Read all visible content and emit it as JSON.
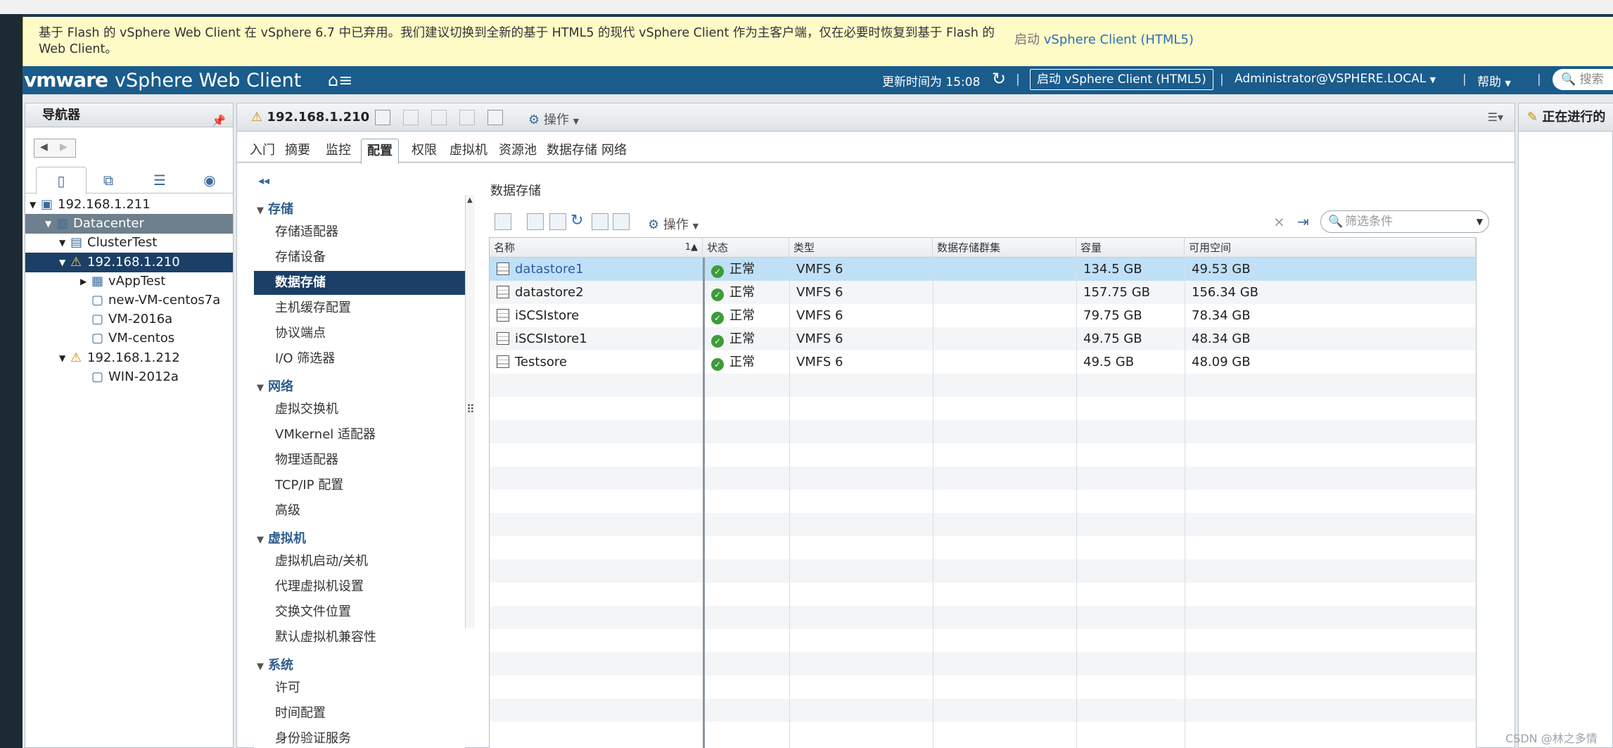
{
  "banner": {
    "message": "基于 Flash 的 vSphere Web Client 在 vSphere 6.7 中已弃用。我们建议切换到全新的基于 HTML5 的现代 vSphere Client 作为主客户端，仅在必要时恢复到基于 Flash 的 Web Client。",
    "link_prefix": "启动",
    "link_text": "vSphere Client (HTML5)"
  },
  "header": {
    "brand": "vmware",
    "product": "vSphere Web Client",
    "update_time": "更新时间为 15:08",
    "launch_html5": "启动 vSphere Client (HTML5)",
    "user": "Administrator@VSPHERE.LOCAL",
    "help": "帮助",
    "search_placeholder": "搜索"
  },
  "navigator": {
    "title": "导航器",
    "tree": [
      {
        "label": "192.168.1.211",
        "level": 0,
        "icon": "vcenter-icon",
        "expanded": true
      },
      {
        "label": "Datacenter",
        "level": 1,
        "icon": "datacenter-icon",
        "expanded": true,
        "selected": "gray"
      },
      {
        "label": "ClusterTest",
        "level": 2,
        "icon": "cluster-icon",
        "expanded": true
      },
      {
        "label": "192.168.1.210",
        "level": 3,
        "icon": "host-warning-icon",
        "expanded": true,
        "selected": "blue"
      },
      {
        "label": "vAppTest",
        "level": 4,
        "icon": "vapp-icon",
        "expanded": false
      },
      {
        "label": "new-VM-centos7a",
        "level": 4,
        "icon": "vm-icon"
      },
      {
        "label": "VM-2016a",
        "level": 4,
        "icon": "vm-icon"
      },
      {
        "label": "VM-centos",
        "level": 4,
        "icon": "vm-icon"
      },
      {
        "label": "192.168.1.212",
        "level": 3,
        "icon": "host-warning-icon",
        "expanded": true
      },
      {
        "label": "WIN-2012a",
        "level": 4,
        "icon": "vm-icon"
      }
    ]
  },
  "host": {
    "title": "192.168.1.210",
    "actions": "操作",
    "tabs": [
      "入门",
      "摘要",
      "监控",
      "配置",
      "权限",
      "虚拟机",
      "资源池",
      "数据存储",
      "网络"
    ],
    "active_tab": "配置"
  },
  "config_menu": {
    "groups": [
      {
        "label": "存储",
        "items": [
          "存储适配器",
          "存储设备",
          "数据存储",
          "主机缓存配置",
          "协议端点",
          "I/O 筛选器"
        ]
      },
      {
        "label": "网络",
        "items": [
          "虚拟交换机",
          "VMkernel 适配器",
          "物理适配器",
          "TCP/IP 配置",
          "高级"
        ]
      },
      {
        "label": "虚拟机",
        "items": [
          "虚拟机启动/关机",
          "代理虚拟机设置",
          "交换文件位置",
          "默认虚拟机兼容性"
        ]
      },
      {
        "label": "系统",
        "items": [
          "许可",
          "时间配置",
          "身份验证服务"
        ]
      }
    ],
    "active_item": "数据存储"
  },
  "datastores": {
    "title": "数据存储",
    "actions": "操作",
    "filter_placeholder": "筛选条件",
    "columns": [
      "名称",
      "状态",
      "类型",
      "数据存储群集",
      "容量",
      "可用空间"
    ],
    "sort_indicator": "1▲",
    "rows": [
      {
        "name": "datastore1",
        "status": "正常",
        "type": "VMFS 6",
        "cluster": "",
        "capacity": "134.5 GB",
        "free": "49.53 GB"
      },
      {
        "name": "datastore2",
        "status": "正常",
        "type": "VMFS 6",
        "cluster": "",
        "capacity": "157.75 GB",
        "free": "156.34 GB"
      },
      {
        "name": "iSCSIstore",
        "status": "正常",
        "type": "VMFS 6",
        "cluster": "",
        "capacity": "79.75 GB",
        "free": "78.34 GB"
      },
      {
        "name": "iSCSIstore1",
        "status": "正常",
        "type": "VMFS 6",
        "cluster": "",
        "capacity": "49.75 GB",
        "free": "48.34 GB"
      },
      {
        "name": "Testsore",
        "status": "正常",
        "type": "VMFS 6",
        "cluster": "",
        "capacity": "49.5 GB",
        "free": "48.09 GB"
      }
    ]
  },
  "right_panel": {
    "title": "正在进行的"
  },
  "watermark": "CSDN @林之多情"
}
